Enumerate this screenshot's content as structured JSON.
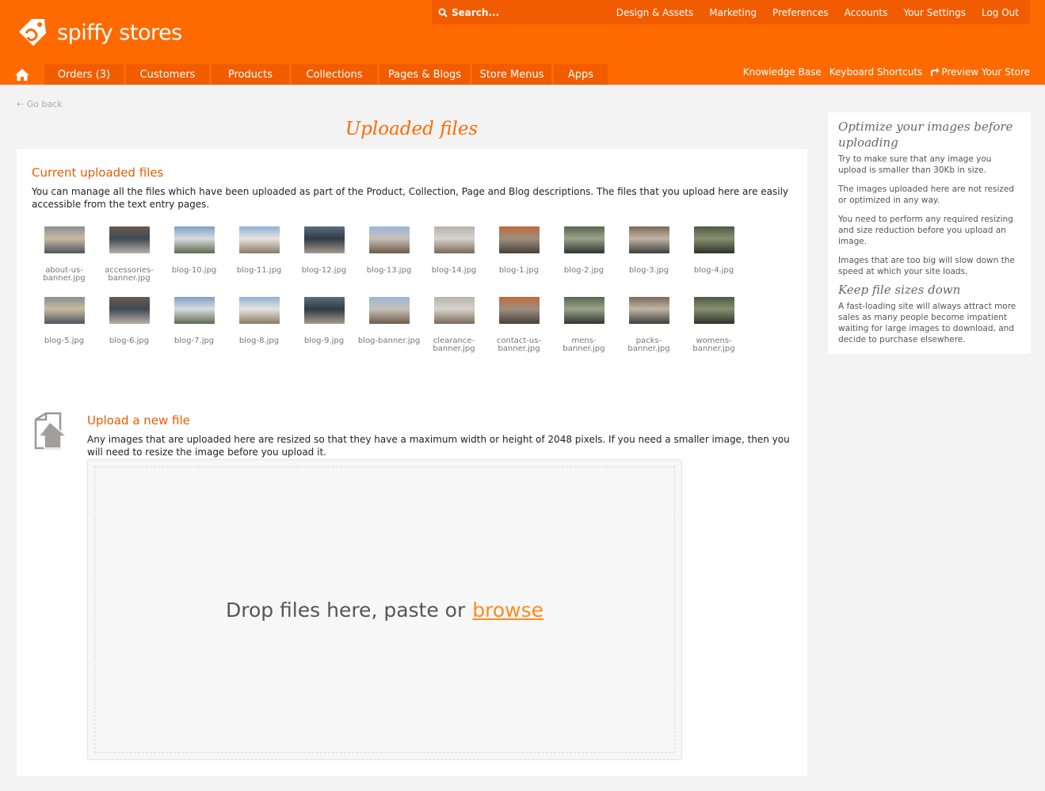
{
  "brand": {
    "name": "spiffy stores",
    "accent": "#ff6a00",
    "bar_dark": "#f25c00"
  },
  "topbar": {
    "search_placeholder": "Search...",
    "links": [
      "Design & Assets",
      "Marketing",
      "Preferences",
      "Accounts",
      "Your Settings",
      "Log Out"
    ]
  },
  "nav": {
    "home_icon": "home-icon",
    "tabs": [
      "Orders (3)",
      "Customers",
      "Products",
      "Collections",
      "Pages & Blogs",
      "Store Menus",
      "Apps"
    ],
    "right_links": [
      "Knowledge Base",
      "Keyboard Shortcuts",
      "Preview Your Store"
    ]
  },
  "go_back": "Go back",
  "page_title": "Uploaded files",
  "current": {
    "title": "Current uploaded files",
    "description": "You can manage all the files which have been uploaded as part of the Product, Collection, Page and Blog descriptions. The files that you upload here are easily accessible from the text entry pages.",
    "files": [
      "about-us-banner.jpg",
      "accessories-banner.jpg",
      "blog-10.jpg",
      "blog-11.jpg",
      "blog-12.jpg",
      "blog-13.jpg",
      "blog-14.jpg",
      "blog-1.jpg",
      "blog-2.jpg",
      "blog-3.jpg",
      "blog-4.jpg",
      "blog-5.jpg",
      "blog-6.jpg",
      "blog-7.jpg",
      "blog-8.jpg",
      "blog-9.jpg",
      "blog-banner.jpg",
      "clearance-banner.jpg",
      "contact-us-banner.jpg",
      "mens-banner.jpg",
      "packs-banner.jpg",
      "womens-banner.jpg"
    ]
  },
  "upload": {
    "title": "Upload a new file",
    "description": "Any images that are uploaded here are resized so that they have a maximum width or height of 2048 pixels. If you need a smaller image, then you will need to resize the image before you upload it.",
    "drop_text": "Drop files here, paste or",
    "browse_label": "browse"
  },
  "sidebar": {
    "heading1": "Optimize your images before uploading",
    "p1": "Try to make sure that any image you upload is smaller than 30Kb in size.",
    "p2": "The images uploaded here are not resized or optimized in any way.",
    "p3": "You need to perform any required resizing and size reduction before you upload an image.",
    "p4": "Images that are too big will slow down the speed at which your site loads.",
    "heading2": "Keep file sizes down",
    "p5": "A fast-loading site will always attract more sales as many people become impatient waiting for large images to download, and decide to purchase elsewhere."
  }
}
